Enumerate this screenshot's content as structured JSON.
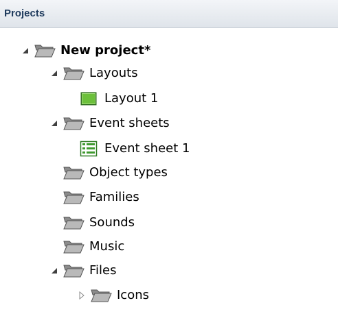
{
  "panel": {
    "title": "Projects"
  },
  "tree": {
    "root": {
      "label": "New project*",
      "expanded": true
    },
    "layouts": {
      "label": "Layouts",
      "expanded": true
    },
    "layout_1": {
      "label": "Layout 1"
    },
    "event_sheets": {
      "label": "Event sheets",
      "expanded": true
    },
    "event_sheet_1": {
      "label": "Event sheet 1"
    },
    "object_types": {
      "label": "Object types"
    },
    "families": {
      "label": "Families"
    },
    "sounds": {
      "label": "Sounds"
    },
    "music": {
      "label": "Music"
    },
    "files": {
      "label": "Files",
      "expanded": true
    },
    "icons": {
      "label": "Icons",
      "expanded": false
    }
  },
  "icons": {
    "folder": "folder-open-icon",
    "layout": "layout-icon",
    "event_sheet": "event-sheet-icon",
    "expanded": "triangle-expanded-icon",
    "collapsed": "triangle-collapsed-icon"
  },
  "colors": {
    "header_text": "#1e3a5c",
    "folder": "#6e6e6e",
    "layout_green": "#5aa532",
    "event_sheet_green": "#3f9a2f"
  }
}
